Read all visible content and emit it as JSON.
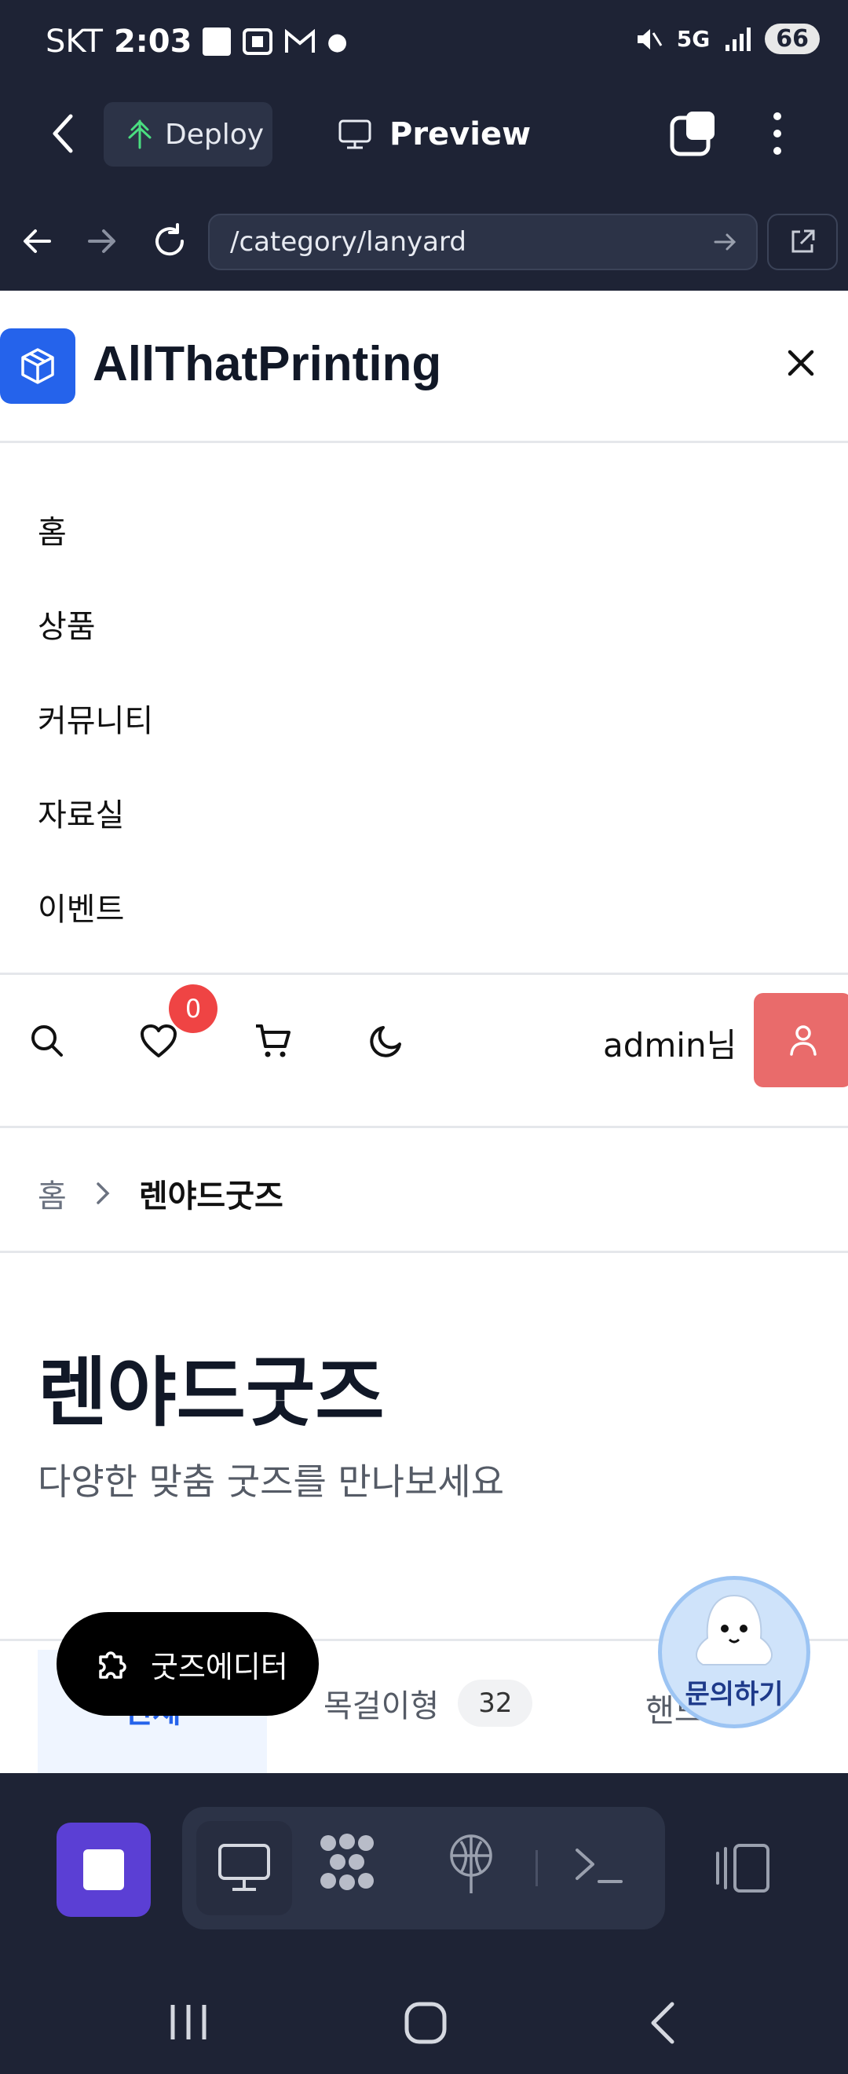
{
  "status_bar": {
    "carrier": "SKT",
    "time": "2:03",
    "network": "5G",
    "battery": "66"
  },
  "toolbar": {
    "deploy_label": "Deploy",
    "preview_label": "Preview"
  },
  "browser": {
    "url": "/category/lanyard"
  },
  "site": {
    "brand": "AllThatPrinting"
  },
  "menu": {
    "items": [
      "홈",
      "상품",
      "커뮤니티",
      "자료실",
      "이벤트"
    ]
  },
  "header": {
    "wishlist_count": "0",
    "user_label": "admin님"
  },
  "breadcrumb": {
    "home": "홈",
    "current": "렌야드굿즈"
  },
  "category": {
    "title": "렌야드굿즈",
    "subtitle": "다양한 맞춤 굿즈를 만나보세요"
  },
  "tabs": [
    {
      "label": "전체"
    },
    {
      "label": "목걸이형",
      "count": "32"
    },
    {
      "label": "핸드"
    }
  ],
  "floating": {
    "goods_editor": "굿즈에디터",
    "inquiry": "문의하기"
  },
  "colors": {
    "accent": "#2563eb",
    "danger": "#ef4444",
    "user_button": "#e96b6b",
    "ide_bg": "#1e2335",
    "stop_button": "#5b3fd4"
  }
}
